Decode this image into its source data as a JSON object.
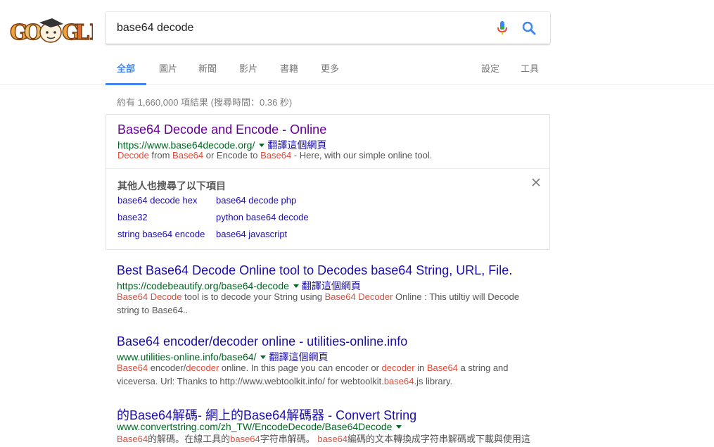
{
  "search": {
    "query": "base64 decode"
  },
  "tabs": [
    {
      "label": "全部",
      "active": true
    },
    {
      "label": "圖片"
    },
    {
      "label": "新聞"
    },
    {
      "label": "影片"
    },
    {
      "label": "書籍"
    },
    {
      "label": "更多"
    },
    {
      "label": "設定"
    },
    {
      "label": "工具"
    }
  ],
  "stats": "約有 1,660,000 項結果 (搜尋時間：0.36 秒)",
  "results": [
    {
      "title": "Base64 Decode and Encode - Online",
      "url": "https://www.base64decode.org/",
      "translate": "翻譯這個網頁",
      "snippet": [
        {
          "t": "Decode",
          "hl": true
        },
        {
          "t": " from "
        },
        {
          "t": "Base64",
          "hl": true
        },
        {
          "t": " or Encode to "
        },
        {
          "t": "Base64",
          "hl": true
        },
        {
          "t": " - Here, with our simple online tool."
        }
      ]
    },
    {
      "title": "Best Base64 Decode Online tool to Decodes base64 String, URL, File.",
      "url": "https://codebeautify.org/base64-decode",
      "translate": "翻譯這個網頁",
      "snippet": [
        {
          "t": "Base64 Decode",
          "hl": true
        },
        {
          "t": " tool is to decode your String using "
        },
        {
          "t": "Base64 Decoder",
          "hl": true
        },
        {
          "t": " Online : This utiltiy will Decode string to Base64.."
        }
      ]
    },
    {
      "title": "Base64 encoder/decoder online - utilities-online.info",
      "url": "www.utilities-online.info/base64/",
      "translate": "翻譯這個網頁",
      "snippet": [
        {
          "t": "Base64",
          "hl": true
        },
        {
          "t": " encoder/"
        },
        {
          "t": "decoder",
          "hl": true
        },
        {
          "t": " online. In this page you can encoder or "
        },
        {
          "t": "decoder",
          "hl": true
        },
        {
          "t": " in "
        },
        {
          "t": "Base64",
          "hl": true
        },
        {
          "t": " a string and viceversa. Url: Thanks to http://www.webtoolkit.info/ for webtoolkit."
        },
        {
          "t": "base64",
          "hl": true
        },
        {
          "t": ".js library."
        }
      ]
    },
    {
      "title": "的Base64解碼- 網上的Base64解碼器 - Convert String",
      "url": "www.convertstring.com/zh_TW/EncodeDecode/Base64Decode",
      "snippet": [
        {
          "t": "Base64",
          "hl": true
        },
        {
          "t": "的解碼。在線工具的"
        },
        {
          "t": "base64",
          "hl": true
        },
        {
          "t": "字符串解碼。 "
        },
        {
          "t": "base64",
          "hl": true
        },
        {
          "t": "編碼的文本轉換成字符串解碼或下載與使用這"
        }
      ]
    }
  ],
  "people_also_search": {
    "heading": "其他人也搜尋了以下項目",
    "items": [
      "base64 decode hex",
      "base64 decode php",
      "base32",
      "python base64 decode",
      "string base64 encode",
      "base64 javascript"
    ]
  },
  "colors": {
    "link": "#1a0dab",
    "visited": "#660099",
    "url": "#006621",
    "highlight": "#dd4b39",
    "accent": "#4285f4"
  }
}
